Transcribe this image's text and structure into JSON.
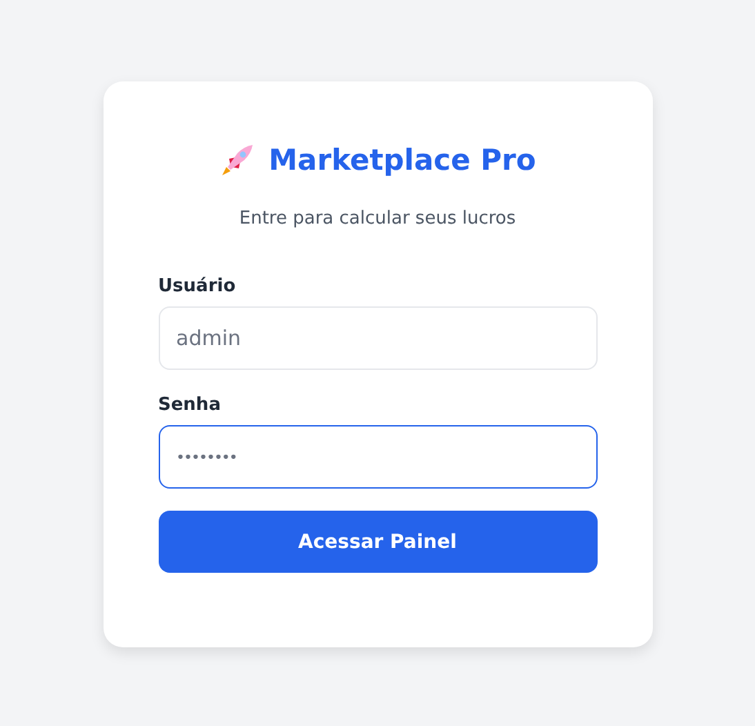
{
  "title": "Marketplace Pro",
  "subtitle": "Entre para calcular seus lucros",
  "fields": [
    {
      "label": "Usuário",
      "kind": "text",
      "placeholder": "admin",
      "focused": false
    },
    {
      "label": "Senha",
      "kind": "password",
      "placeholder": "••••••••",
      "focused": true
    }
  ],
  "button": "Acessar Painel"
}
